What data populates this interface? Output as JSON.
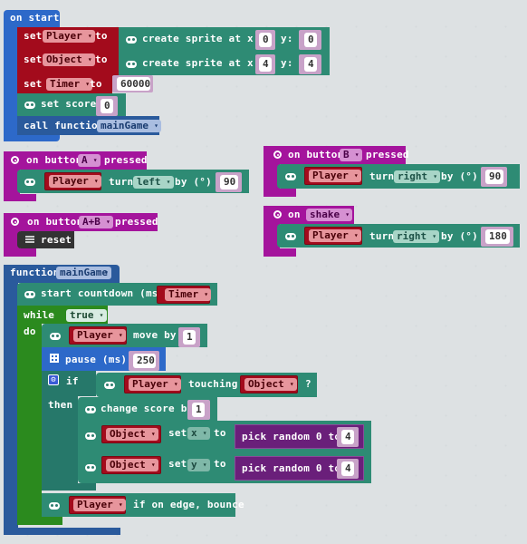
{
  "on_start": {
    "header": "on start",
    "set_label": "set",
    "to_label": "to",
    "rows": [
      {
        "variable": "Player",
        "create_label": "create sprite at x:",
        "x": "0",
        "y_label": "y:",
        "y": "0"
      },
      {
        "variable": "Object",
        "create_label": "create sprite at x:",
        "x": "4",
        "y_label": "y:",
        "y": "4"
      }
    ],
    "timer": {
      "variable": "Timer",
      "value": "60000"
    },
    "set_score": {
      "label": "set score",
      "value": "0"
    },
    "call": {
      "label": "call function",
      "function": "mainGame"
    }
  },
  "button_a": {
    "on": "on button",
    "button": "A",
    "pressed": "pressed",
    "sprite": "Player",
    "turn": "turn",
    "direction": "left",
    "by": "by (°)",
    "value": "90"
  },
  "button_ab": {
    "on": "on button",
    "button": "A+B",
    "pressed": "pressed",
    "action": "reset"
  },
  "button_b": {
    "on": "on button",
    "button": "B",
    "pressed": "pressed",
    "sprite": "Player",
    "turn": "turn",
    "direction": "right",
    "by": "by (°)",
    "value": "90"
  },
  "shake": {
    "on": "on",
    "gesture": "shake",
    "sprite": "Player",
    "turn": "turn",
    "direction": "right",
    "by": "by (°)",
    "value": "180"
  },
  "main_game": {
    "header": "function",
    "name": "mainGame",
    "countdown": {
      "label": "start countdown (ms)",
      "variable": "Timer"
    },
    "while_label": "while",
    "condition": "true",
    "do_label": "do",
    "move": {
      "sprite": "Player",
      "label": "move by",
      "value": "1"
    },
    "pause": {
      "label": "pause (ms)",
      "value": "250"
    },
    "if_label": "if",
    "then_label": "then",
    "touching": {
      "sprite": "Player",
      "label": "touching",
      "target": "Object",
      "q": "?"
    },
    "change_score": {
      "label": "change score by",
      "value": "1"
    },
    "set_x": {
      "sprite": "Object",
      "set": "set",
      "prop": "x",
      "to": "to",
      "random": "pick random 0 to",
      "value": "4"
    },
    "set_y": {
      "sprite": "Object",
      "set": "set",
      "prop": "y",
      "to": "to",
      "random": "pick random 0 to",
      "value": "4"
    },
    "bounce": {
      "sprite": "Player",
      "label": "if on edge, bounce"
    }
  }
}
